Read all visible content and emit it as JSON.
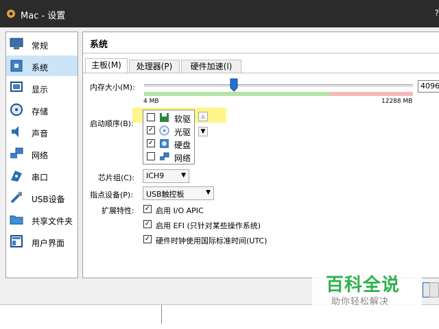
{
  "window": {
    "title": "Mac - 设置",
    "help": "?"
  },
  "sidebar": {
    "items": [
      {
        "label": "常规",
        "icon": "monitor-icon"
      },
      {
        "label": "系统",
        "icon": "chip-icon"
      },
      {
        "label": "显示",
        "icon": "display-icon"
      },
      {
        "label": "存储",
        "icon": "disk-icon"
      },
      {
        "label": "声音",
        "icon": "speaker-icon"
      },
      {
        "label": "网络",
        "icon": "network-icon"
      },
      {
        "label": "串口",
        "icon": "serial-icon"
      },
      {
        "label": "USB设备",
        "icon": "usb-icon"
      },
      {
        "label": "共享文件夹",
        "icon": "folder-icon"
      },
      {
        "label": "用户界面",
        "icon": "ui-icon"
      }
    ],
    "active_index": 1
  },
  "main": {
    "title": "系统",
    "tabs": [
      {
        "label": "主板(M)",
        "active": true
      },
      {
        "label": "处理器(P)",
        "active": false
      },
      {
        "label": "硬件加速(l)",
        "active": false
      }
    ],
    "memory": {
      "label": "内存大小(M):",
      "min_label": "4 MB",
      "max_label": "12288 MB",
      "value": "4096",
      "value_fraction": 0.333
    },
    "boot": {
      "label": "启动顺序(B):",
      "items": [
        {
          "label": "软驱",
          "checked": false,
          "icon": "floppy-icon"
        },
        {
          "label": "光驱",
          "checked": true,
          "icon": "cd-icon"
        },
        {
          "label": "硬盘",
          "checked": true,
          "icon": "hdd-icon"
        },
        {
          "label": "网络",
          "checked": false,
          "icon": "network-icon"
        }
      ]
    },
    "chipset": {
      "label": "芯片组(C):",
      "value": "ICH9"
    },
    "pointing": {
      "label": "指点设备(P):",
      "value": "USB触控板"
    },
    "features": {
      "label": "扩展特性:",
      "items": [
        {
          "label": "启用 I/O APIC",
          "checked": true
        },
        {
          "label": "启用 EFI (只针对某些操作系统)",
          "checked": true
        },
        {
          "label": "硬件时钟使用国际标准时间(UTC)",
          "checked": true
        }
      ]
    }
  },
  "watermark": {
    "title": "百科全说",
    "subtitle": "助你轻松解决"
  },
  "colors": {
    "titlebar": "#2b2b2b",
    "selection": "#cce4f7",
    "highlight": "#fff58c",
    "watermark_green": "#2fb14b"
  }
}
